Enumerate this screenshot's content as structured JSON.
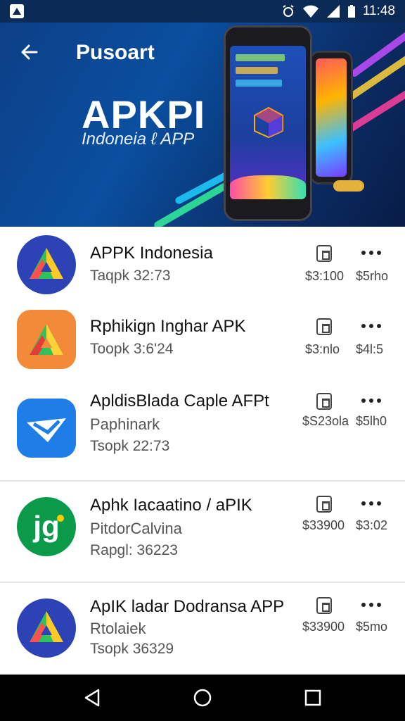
{
  "status_bar": {
    "time": "11:48",
    "icons": [
      "app-notification-icon",
      "alarm-icon",
      "wifi-icon",
      "signal-icon",
      "battery-icon"
    ]
  },
  "header": {
    "title": "Pusoart",
    "brand": "APKPI",
    "brand_subtitle": "Indoneia ℓ APP",
    "accent_color": "#0a4fa0"
  },
  "apps": [
    {
      "name": "APPK Indonesia",
      "subtitle": "",
      "meta": "Taqpk 32:73",
      "price": "$3:100",
      "alt_price": "$5rho"
    },
    {
      "name": "Rphikign Inghar APK",
      "subtitle": "",
      "meta": "Toopk 3:6'24",
      "price": "$3:nlo",
      "alt_price": "$4l:5"
    },
    {
      "name": "ApldisBlada Caple AFPt",
      "subtitle": "Paphinark",
      "meta": "Tsopk 22:73",
      "price": "$S23ola",
      "alt_price": "$5lh0"
    },
    {
      "name": "Aphk Iacaatino / aPIK",
      "subtitle": "PitdorCalvina",
      "meta": "Rapgl: 36223",
      "price": "$33900",
      "alt_price": "$3:02"
    },
    {
      "name": "ApIK ladar Dodransa APP",
      "subtitle": "Rtolaiek",
      "meta": "Tsopk 36329",
      "price": "$33900",
      "alt_price": "$5mo"
    }
  ],
  "nav": {
    "back": "back-triangle-icon",
    "home": "home-circle-icon",
    "recents": "recents-square-icon"
  }
}
